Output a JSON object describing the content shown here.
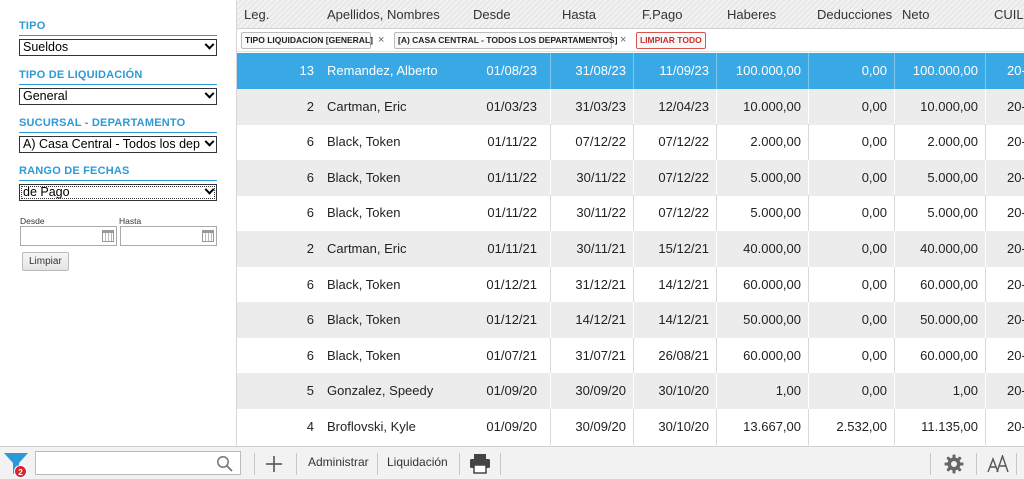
{
  "sidebar": {
    "filters": [
      {
        "title": "TIPO",
        "value": "Sueldos"
      },
      {
        "title": "TIPO DE LIQUIDACIÓN",
        "value": "General"
      },
      {
        "title": "SUCURSAL - DEPARTAMENTO",
        "value": "A) Casa Central - Todos los dep"
      },
      {
        "title": "RANGO DE FECHAS",
        "value": "de Pago"
      }
    ],
    "date_from_label": "Desde",
    "date_to_label": "Hasta",
    "date_from_value": "",
    "date_to_value": "",
    "clear_label": "Limpiar"
  },
  "table": {
    "columns": [
      "Leg.",
      "Apellidos, Nombres",
      "Desde",
      "Hasta",
      "F.Pago",
      "Haberes",
      "Deducciones",
      "Neto",
      "CUIL"
    ],
    "chips": [
      {
        "label": "TIPO LIQUIDACION [GENERAL]",
        "close": "×"
      },
      {
        "label": "[A) CASA CENTRAL - TODOS LOS DEPARTAMENTOS]",
        "close": "×"
      }
    ],
    "clear_all_label": "LIMPIAR TODO",
    "rows": [
      {
        "leg": "13",
        "name": "Remandez, Alberto",
        "desde": "01/08/23",
        "hasta": "31/08/23",
        "fpago": "11/09/23",
        "haberes": "100.000,00",
        "deducciones": "0,00",
        "neto": "100.000,00",
        "cuil": "20-"
      },
      {
        "leg": "2",
        "name": "Cartman, Eric",
        "desde": "01/03/23",
        "hasta": "31/03/23",
        "fpago": "12/04/23",
        "haberes": "10.000,00",
        "deducciones": "0,00",
        "neto": "10.000,00",
        "cuil": "20-"
      },
      {
        "leg": "6",
        "name": "Black, Token",
        "desde": "01/11/22",
        "hasta": "07/12/22",
        "fpago": "07/12/22",
        "haberes": "2.000,00",
        "deducciones": "0,00",
        "neto": "2.000,00",
        "cuil": "20-"
      },
      {
        "leg": "6",
        "name": "Black, Token",
        "desde": "01/11/22",
        "hasta": "30/11/22",
        "fpago": "07/12/22",
        "haberes": "5.000,00",
        "deducciones": "0,00",
        "neto": "5.000,00",
        "cuil": "20-"
      },
      {
        "leg": "6",
        "name": "Black, Token",
        "desde": "01/11/22",
        "hasta": "30/11/22",
        "fpago": "07/12/22",
        "haberes": "5.000,00",
        "deducciones": "0,00",
        "neto": "5.000,00",
        "cuil": "20-"
      },
      {
        "leg": "2",
        "name": "Cartman, Eric",
        "desde": "01/11/21",
        "hasta": "30/11/21",
        "fpago": "15/12/21",
        "haberes": "40.000,00",
        "deducciones": "0,00",
        "neto": "40.000,00",
        "cuil": "20-"
      },
      {
        "leg": "6",
        "name": "Black, Token",
        "desde": "01/12/21",
        "hasta": "31/12/21",
        "fpago": "14/12/21",
        "haberes": "60.000,00",
        "deducciones": "0,00",
        "neto": "60.000,00",
        "cuil": "20-"
      },
      {
        "leg": "6",
        "name": "Black, Token",
        "desde": "01/12/21",
        "hasta": "14/12/21",
        "fpago": "14/12/21",
        "haberes": "50.000,00",
        "deducciones": "0,00",
        "neto": "50.000,00",
        "cuil": "20-"
      },
      {
        "leg": "6",
        "name": "Black, Token",
        "desde": "01/07/21",
        "hasta": "31/07/21",
        "fpago": "26/08/21",
        "haberes": "60.000,00",
        "deducciones": "0,00",
        "neto": "60.000,00",
        "cuil": "20-"
      },
      {
        "leg": "5",
        "name": "Gonzalez, Speedy",
        "desde": "01/09/20",
        "hasta": "30/09/20",
        "fpago": "30/10/20",
        "haberes": "1,00",
        "deducciones": "0,00",
        "neto": "1,00",
        "cuil": "20-"
      },
      {
        "leg": "4",
        "name": "Broflovski, Kyle",
        "desde": "01/09/20",
        "hasta": "30/09/20",
        "fpago": "30/10/20",
        "haberes": "13.667,00",
        "deducciones": "2.532,00",
        "neto": "11.135,00",
        "cuil": "20-"
      }
    ]
  },
  "toolbar": {
    "filter_badge": "2",
    "search_value": "",
    "administrar_label": "Administrar",
    "liquidacion_label": "Liquidación",
    "icons": [
      "filter-icon",
      "search-icon",
      "plus-icon",
      "printer-icon",
      "gear-icon",
      "font-size-icon"
    ]
  },
  "colors": {
    "accent": "#2c9ad6",
    "selected_row": "#39a9e6",
    "badge": "#d9232e"
  }
}
